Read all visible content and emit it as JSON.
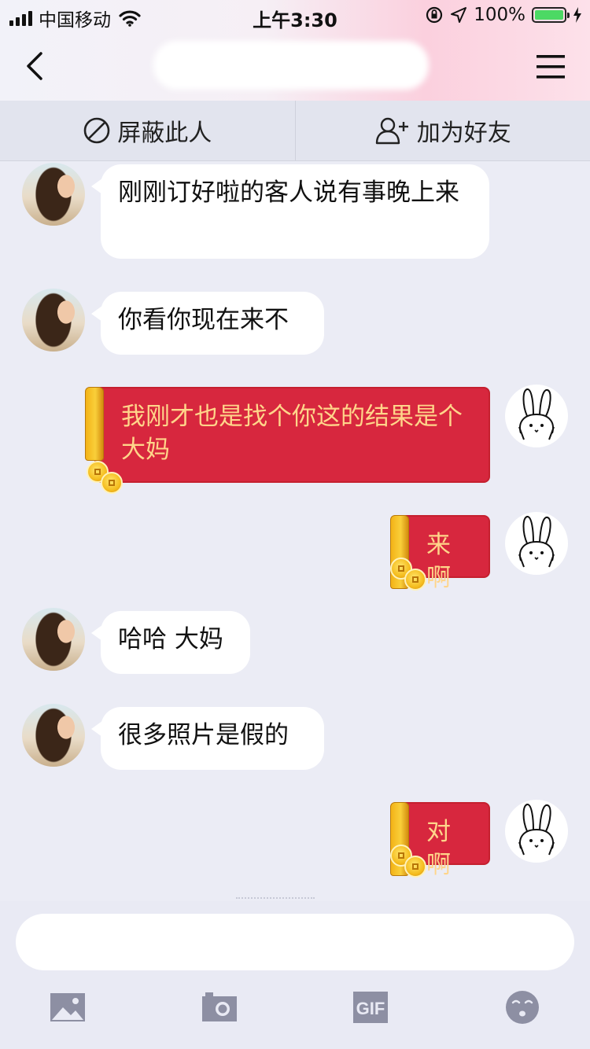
{
  "status_bar": {
    "carrier": "中国移动",
    "time": "上午3:30",
    "battery": "100%",
    "battery_level": 1.0
  },
  "header": {
    "title": ""
  },
  "actions": {
    "block_label": "屏蔽此人",
    "add_friend_label": "加为好友"
  },
  "messages": [
    {
      "side": "left",
      "style": "plain",
      "text": "刚刚订好啦的客人说有事晚上来"
    },
    {
      "side": "left",
      "style": "plain",
      "text": "你看你现在来不"
    },
    {
      "side": "right",
      "style": "red-envelope",
      "text": "我刚才也是找个你这的结果是个大妈"
    },
    {
      "side": "right",
      "style": "red-envelope",
      "text": "来啊"
    },
    {
      "side": "left",
      "style": "plain",
      "text": "哈哈 大妈"
    },
    {
      "side": "left",
      "style": "plain",
      "text": "很多照片是假的"
    },
    {
      "side": "right",
      "style": "red-envelope",
      "text": "对啊"
    }
  ],
  "composer": {
    "placeholder": ""
  },
  "toolbar": {
    "icons": [
      "image-icon",
      "camera-icon",
      "gif-icon",
      "emoji-icon"
    ],
    "gif_label": "GIF"
  },
  "colors": {
    "background": "#ebecf5",
    "red_envelope": "#d7273e",
    "red_envelope_text": "#ffd58a",
    "battery_green": "#4cd964"
  }
}
